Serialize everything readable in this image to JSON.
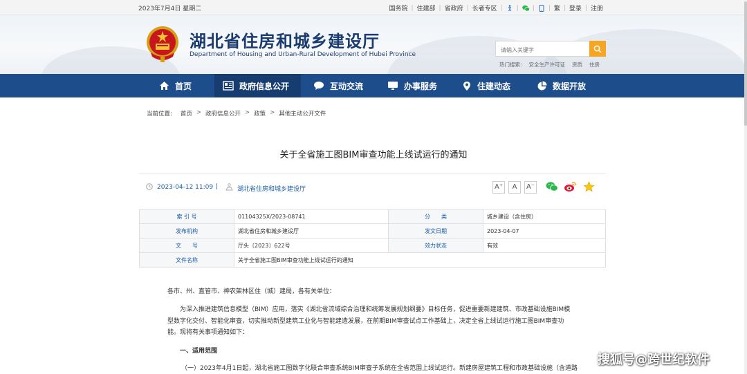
{
  "topbar": {
    "date": "2023年7月4日 星期二",
    "links": [
      "国务院",
      "住建部",
      "省政府",
      "长者专区"
    ],
    "traditional": "繁",
    "login": "登录",
    "register": "注册"
  },
  "header": {
    "title": "湖北省住房和城乡建设厅",
    "subtitle": "Department of Housing and Urban-Rural Development of Hubei Province",
    "search_placeholder": "请输入关键字",
    "hot_label": "热门搜索:",
    "hot_items": [
      "安全生产许可证",
      "资质",
      "住房"
    ]
  },
  "nav": {
    "items": [
      "首页",
      "政府信息公开",
      "互动交流",
      "办事服务",
      "住建动态",
      "数据开放"
    ]
  },
  "breadcrumb": {
    "label": "当前位置:",
    "items": [
      "首页",
      "政府信息公开",
      "政策",
      "其他主动公开文件"
    ]
  },
  "article": {
    "title": "关于全省施工图BIM审查功能上线试运行的通知",
    "time": "2023-04-12 11:09",
    "divider": "|",
    "source": "湖北省住房和城乡建设厅",
    "font_buttons": [
      "A⁺",
      "A",
      "A⁻"
    ]
  },
  "info": {
    "index_label": "索 引 号",
    "index_value": "01104325X/2023-08741",
    "category_label": "分　　类",
    "category_value": "城乡建设（含住房）",
    "issuer_label": "发布机构",
    "issuer_value": "湖北省住房和城乡建设厅",
    "date_label": "发文日期",
    "date_value": "2023-04-07",
    "docno_label": "文　　号",
    "docno_value": "厅头〔2023〕622号",
    "status_label": "效力状态",
    "status_value": "有效",
    "name_label": "文件名称",
    "name_value": "关于全省施工图BIM审查功能上线试运行的通知"
  },
  "body": {
    "salutation": "各市、州、直管市、神农架林区住（城）建局，各有关单位：",
    "para1_line1": "为深入推进建筑信息模型（BIM）应用，落实《湖北省流域综合治理和统筹发展规划纲要》目标任务，促进重要新建建筑、市政基础设施BIM模",
    "para1_line2": "型数字化交付、智能化审查，切实推动新型建筑工业化与智能建造发展，在前期BIM审查试点工作基础上，决定全省上线试运行施工图BIM审查功",
    "para1_line3": "能。现将有关事项通知如下：",
    "section1": "一、适用范围",
    "para2": "（一）2023年4月1日起，湖北省施工图数字化联合审查系统BIM审查子系统在全省范围上线试运行。新建房屋建筑工程和市政基础设施（含道路"
  },
  "watermark": "搜狐号@跨世纪软件",
  "colors": {
    "nav_bg": "#1e4d8c",
    "nav_active": "#163c70",
    "title_blue": "#1a3b70",
    "link_blue": "#1a5da8",
    "search_btn": "#f5a623"
  }
}
